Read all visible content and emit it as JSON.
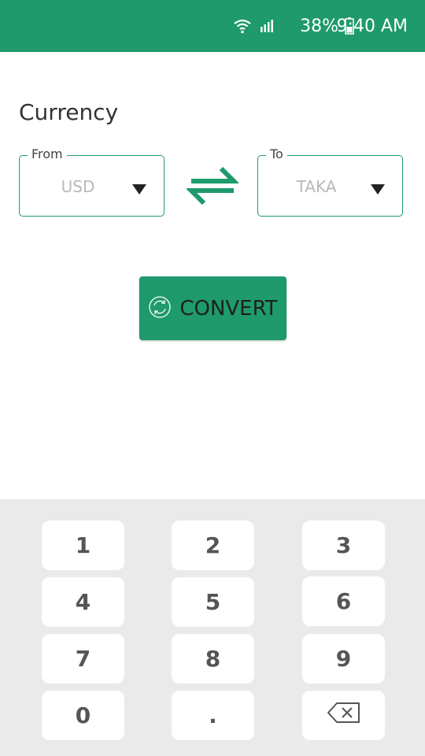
{
  "status_bar": {
    "battery": "38%",
    "time": "9:40 AM",
    "icons": [
      "wifi-icon",
      "signal-icon",
      "battery-icon"
    ]
  },
  "title": "Currency",
  "from": {
    "label": "From",
    "value": "USD"
  },
  "to": {
    "label": "To",
    "value": "TAKA"
  },
  "convert_button": {
    "label": "CONVERT",
    "icon": "refresh-icon"
  },
  "keypad": {
    "keys": [
      "1",
      "2",
      "3",
      "4",
      "5",
      "6",
      "7",
      "8",
      "9",
      "0",
      ".",
      "⌫"
    ],
    "backspace_icon": "backspace-icon"
  },
  "colors": {
    "accent": "#1e9a6c",
    "keypad_bg": "#eaeaea",
    "placeholder": "#b8b8b8"
  }
}
